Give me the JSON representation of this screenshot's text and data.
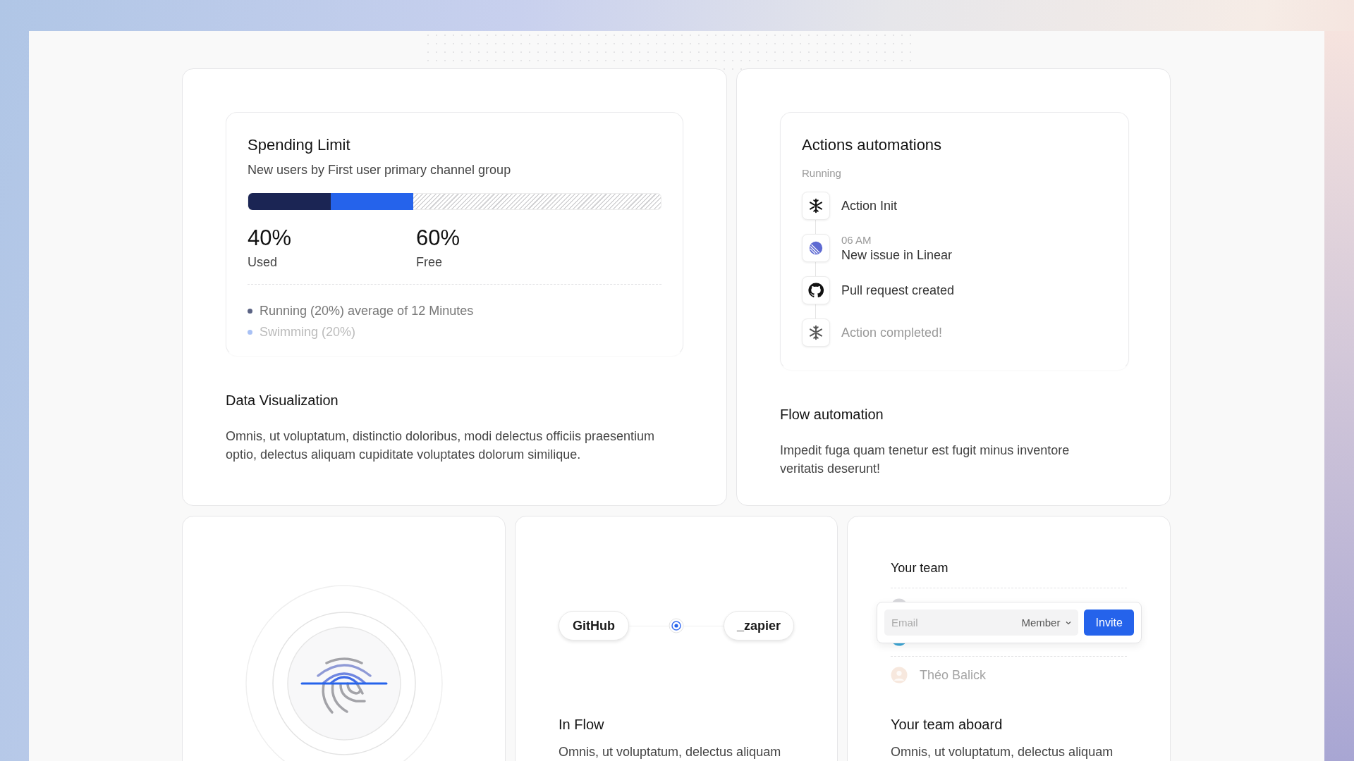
{
  "spending": {
    "title": "Spending Limit",
    "subtitle": "New users by First user primary channel group",
    "segments": [
      {
        "level": 0.2,
        "color": "#1b2554"
      },
      {
        "level": 0.2,
        "color": "#2563eb"
      }
    ],
    "stats": [
      {
        "value": "40%",
        "label": "Used"
      },
      {
        "value": "60%",
        "label": "Free"
      }
    ],
    "legend": [
      {
        "text": "Running (20%) average of 12 Minutes",
        "color": "#5b6384",
        "disabled": false
      },
      {
        "text": "Swimming (20%)",
        "color": "#a8c1f5",
        "disabled": true
      }
    ]
  },
  "data_visualization": {
    "title": "Data Visualization",
    "description": "Omnis, ut voluptatum, distinctio doloribus, modi delectus officiis praesentium optio, delectus aliquam cupiditate voluptates dolorum similique."
  },
  "automations": {
    "title": "Actions automations",
    "status": "Running",
    "steps": [
      {
        "kind": "snowflake",
        "label": "Action Init",
        "disabled": false
      },
      {
        "kind": "linear",
        "time": "06 AM",
        "label": "New issue in Linear",
        "disabled": false
      },
      {
        "kind": "github",
        "label": "Pull request created",
        "disabled": false
      },
      {
        "kind": "snowflake",
        "label": "Action completed!",
        "disabled": true
      }
    ]
  },
  "flow_automation": {
    "title": "Flow automation",
    "description": "Impedit fuga quam tenetur est fugit minus inventore veritatis deserunt!"
  },
  "in_flow": {
    "integrations": [
      {
        "label": "GitHub"
      },
      {
        "label": "_zapier"
      }
    ],
    "title": "In Flow",
    "description": "Omnis, ut voluptatum, delectus aliquam"
  },
  "team": {
    "title": "Your team",
    "members": [
      {
        "disabled": false
      },
      {
        "disabled": false
      },
      {
        "name": "Théo Balick",
        "disabled": true
      }
    ],
    "invite": {
      "placeholder": "Email",
      "role": "Member",
      "button": "Invite"
    },
    "card_title": "Your team aboard",
    "description": "Omnis, ut voluptatum, delectus aliquam"
  }
}
